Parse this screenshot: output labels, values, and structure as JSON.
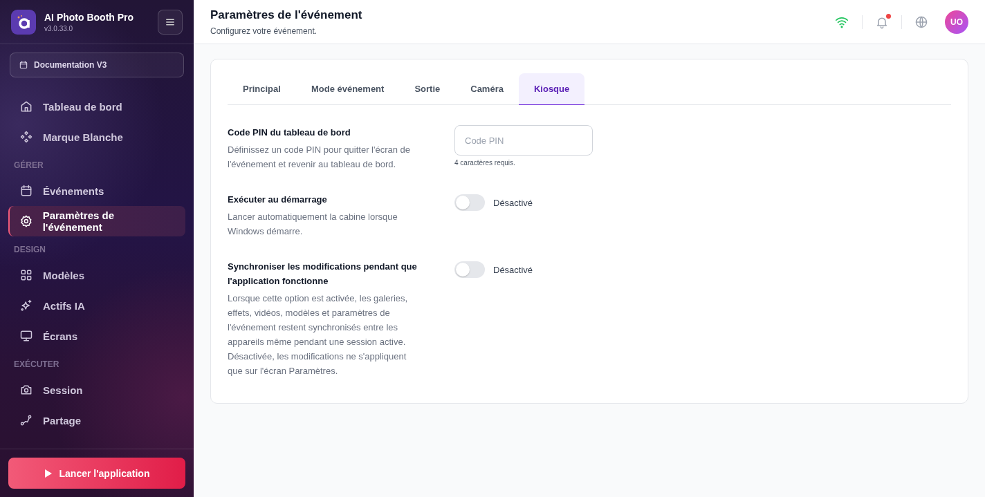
{
  "app": {
    "name": "AI Photo Booth Pro",
    "version": "v3.0.33.0"
  },
  "event_selector": {
    "label": "Documentation V3"
  },
  "sidebar": {
    "sections": [
      {
        "items": [
          {
            "label": "Tableau de bord",
            "selected": false
          },
          {
            "label": "Marque Blanche",
            "selected": false
          }
        ]
      },
      {
        "heading": "GÉRER",
        "items": [
          {
            "label": "Événements",
            "selected": false
          },
          {
            "label": "Paramètres de l'événement",
            "selected": true
          }
        ]
      },
      {
        "heading": "DESIGN",
        "items": [
          {
            "label": "Modèles",
            "selected": false
          },
          {
            "label": "Actifs IA",
            "selected": false
          },
          {
            "label": "Écrans",
            "selected": false
          }
        ]
      },
      {
        "heading": "EXÉCUTER",
        "items": [
          {
            "label": "Session",
            "selected": false
          },
          {
            "label": "Partage",
            "selected": false
          }
        ]
      }
    ]
  },
  "launch_button": {
    "label": "Lancer l'application"
  },
  "header": {
    "title": "Paramètres de l'événement",
    "subtitle": "Configurez votre événement.",
    "notifications_unread": true,
    "avatar": "UO"
  },
  "tabs": [
    {
      "label": "Principal",
      "selected": false
    },
    {
      "label": "Mode événement",
      "selected": false
    },
    {
      "label": "Sortie",
      "selected": false
    },
    {
      "label": "Caméra",
      "selected": false
    },
    {
      "label": "Kiosque",
      "selected": true
    }
  ],
  "settings": [
    {
      "kind": "input",
      "title": "Code PIN du tableau de bord",
      "description": "Définissez un code PIN pour quitter l'écran de l'événement et revenir au tableau de bord.",
      "placeholder": "Code PIN",
      "hint": "4 caractères requis."
    },
    {
      "kind": "toggle",
      "title": "Exécuter au démarrage",
      "description": "Lancer automatiquement la cabine lorsque Windows démarre.",
      "on": false,
      "state_label": "Désactivé"
    },
    {
      "kind": "toggle",
      "title": "Synchroniser les modifications pendant que l'application fonctionne",
      "description": "Lorsque cette option est activée, les galeries, effets, vidéos, modèles et paramètres de l'événement restent synchronisés entre les appareils même pendant une session active. Désactivée, les modifications ne s'appliquent que sur l'écran Paramètres.",
      "on": false,
      "state_label": "Désactivé"
    }
  ]
}
